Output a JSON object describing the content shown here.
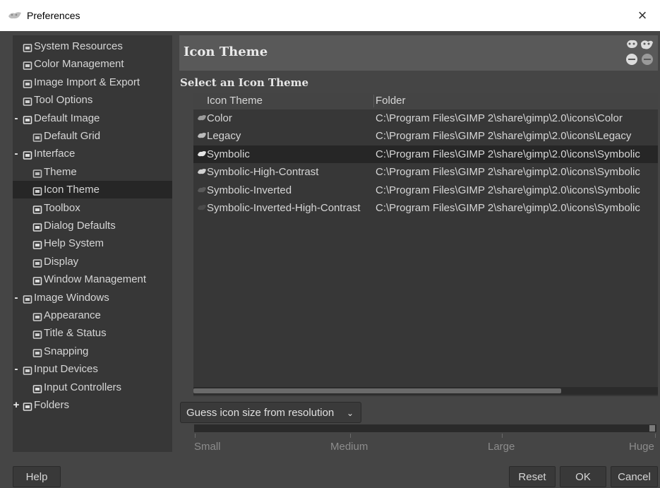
{
  "window": {
    "title": "Preferences",
    "close_glyph": "×"
  },
  "sidebar": {
    "items": [
      {
        "label": "System Resources",
        "icon": "system-resources-icon"
      },
      {
        "label": "Color Management",
        "icon": "color-management-icon"
      },
      {
        "label": "Image Import & Export",
        "icon": "image-import-export-icon"
      },
      {
        "label": "Tool Options",
        "icon": "tool-options-icon"
      },
      {
        "label": "Default Image",
        "icon": "default-image-icon",
        "expander": "-"
      },
      {
        "label": "Default Grid",
        "icon": "default-grid-icon"
      },
      {
        "label": "Interface",
        "icon": "interface-icon",
        "expander": "-"
      },
      {
        "label": "Theme",
        "icon": "theme-icon"
      },
      {
        "label": "Icon Theme",
        "icon": "icon-theme-icon",
        "selected": true
      },
      {
        "label": "Toolbox",
        "icon": "toolbox-icon"
      },
      {
        "label": "Dialog Defaults",
        "icon": "dialog-defaults-icon"
      },
      {
        "label": "Help System",
        "icon": "help-system-icon"
      },
      {
        "label": "Display",
        "icon": "display-icon"
      },
      {
        "label": "Window Management",
        "icon": "window-management-icon"
      },
      {
        "label": "Image Windows",
        "icon": "image-windows-icon",
        "expander": "-"
      },
      {
        "label": "Appearance",
        "icon": "appearance-icon"
      },
      {
        "label": "Title & Status",
        "icon": "title-status-icon"
      },
      {
        "label": "Snapping",
        "icon": "snapping-icon"
      },
      {
        "label": "Input Devices",
        "icon": "input-devices-icon",
        "expander": "-"
      },
      {
        "label": "Input Controllers",
        "icon": "input-controllers-icon"
      },
      {
        "label": "Folders",
        "icon": "folders-icon",
        "expander": "+"
      }
    ]
  },
  "header": {
    "title": "Icon Theme",
    "icon": "wilber-icon"
  },
  "section": {
    "label": "Select an Icon Theme"
  },
  "table": {
    "columns": [
      "Icon Theme",
      "Folder"
    ],
    "rows": [
      {
        "name": "Color",
        "folder": "C:\\Program Files\\GIMP 2\\share\\gimp\\2.0\\icons\\Color"
      },
      {
        "name": "Legacy",
        "folder": "C:\\Program Files\\GIMP 2\\share\\gimp\\2.0\\icons\\Legacy"
      },
      {
        "name": "Symbolic",
        "folder": "C:\\Program Files\\GIMP 2\\share\\gimp\\2.0\\icons\\Symbolic",
        "selected": true
      },
      {
        "name": "Symbolic-High-Contrast",
        "folder": "C:\\Program Files\\GIMP 2\\share\\gimp\\2.0\\icons\\Symbolic"
      },
      {
        "name": "Symbolic-Inverted",
        "folder": "C:\\Program Files\\GIMP 2\\share\\gimp\\2.0\\icons\\Symbolic"
      },
      {
        "name": "Symbolic-Inverted-High-Contrast",
        "folder": "C:\\Program Files\\GIMP 2\\share\\gimp\\2.0\\icons\\Symbolic"
      }
    ]
  },
  "icon_size": {
    "combo_label": "Guess icon size from resolution",
    "combo_glyph": "⌄",
    "scale_labels": [
      "Small",
      "Medium",
      "Large",
      "Huge"
    ],
    "selected_level": "Huge"
  },
  "buttons": {
    "help": "Help",
    "reset": "Reset",
    "ok": "OK",
    "cancel": "Cancel"
  },
  "colors": {
    "background": "#454545",
    "panel": "#373737",
    "selected_row": "#262626",
    "header": "#595959",
    "text": "#d6d6d6",
    "muted_text": "#8c8c8c"
  }
}
